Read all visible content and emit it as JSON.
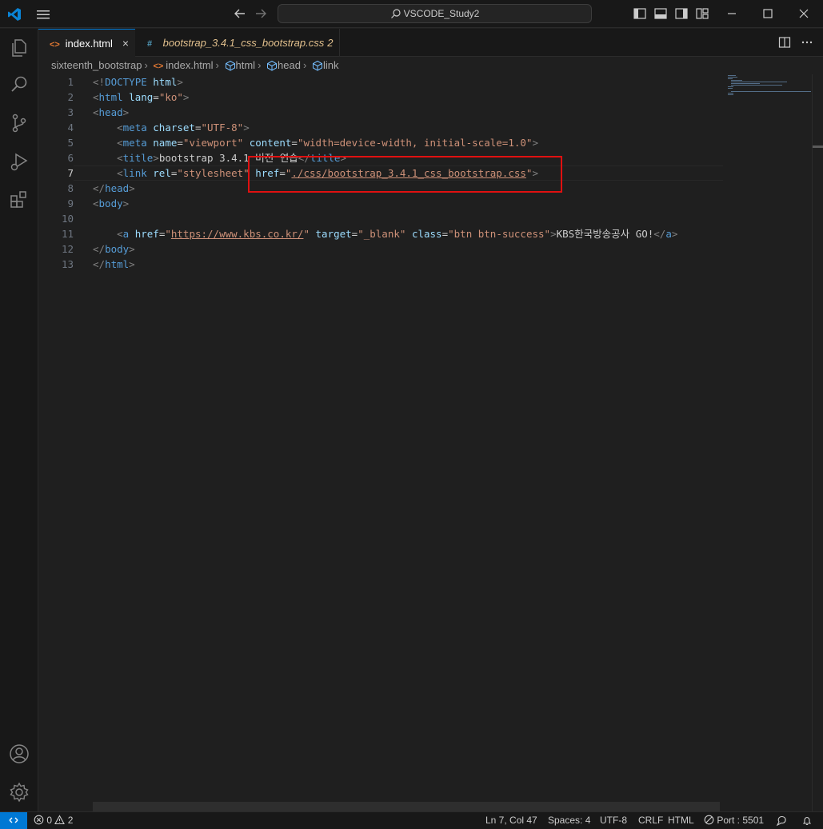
{
  "titlebar": {
    "search_text": "VSCODE_Study2"
  },
  "tabs": [
    {
      "icon": "<>",
      "label": "index.html",
      "close": "×"
    },
    {
      "icon": "#",
      "label": "bootstrap_3.4.1_css_bootstrap.css",
      "badge": "2"
    }
  ],
  "breadcrumb": {
    "folder": "sixteenth_bootstrap",
    "file_icon": "<>",
    "file": "index.html",
    "items": [
      "html",
      "head",
      "link"
    ]
  },
  "editor": {
    "current_line": 7,
    "line_numbers": [
      "1",
      "2",
      "3",
      "4",
      "5",
      "6",
      "7",
      "8",
      "9",
      "10",
      "11",
      "12",
      "13"
    ],
    "lines": [
      [
        [
          "pn",
          "<!"
        ],
        [
          "tg",
          "DOCTYPE"
        ],
        [
          "tx",
          " "
        ],
        [
          "at",
          "html"
        ],
        [
          "pn",
          ">"
        ]
      ],
      [
        [
          "pn",
          "<"
        ],
        [
          "tg",
          "html"
        ],
        [
          "tx",
          " "
        ],
        [
          "at",
          "lang"
        ],
        [
          "tx",
          "="
        ],
        [
          "st",
          "\"ko\""
        ],
        [
          "pn",
          ">"
        ]
      ],
      [
        [
          "pn",
          "<"
        ],
        [
          "tg",
          "head"
        ],
        [
          "pn",
          ">"
        ]
      ],
      [
        [
          "tx",
          "    "
        ],
        [
          "pn",
          "<"
        ],
        [
          "tg",
          "meta"
        ],
        [
          "tx",
          " "
        ],
        [
          "at",
          "charset"
        ],
        [
          "tx",
          "="
        ],
        [
          "st",
          "\"UTF-8\""
        ],
        [
          "pn",
          ">"
        ]
      ],
      [
        [
          "tx",
          "    "
        ],
        [
          "pn",
          "<"
        ],
        [
          "tg",
          "meta"
        ],
        [
          "tx",
          " "
        ],
        [
          "at",
          "name"
        ],
        [
          "tx",
          "="
        ],
        [
          "st",
          "\"viewport\""
        ],
        [
          "tx",
          " "
        ],
        [
          "at",
          "content"
        ],
        [
          "tx",
          "="
        ],
        [
          "st",
          "\"width=device-width, initial-scale=1.0\""
        ],
        [
          "pn",
          ">"
        ]
      ],
      [
        [
          "tx",
          "    "
        ],
        [
          "pn",
          "<"
        ],
        [
          "tg",
          "title"
        ],
        [
          "pn",
          ">"
        ],
        [
          "tx",
          "bootstrap 3.4.1 버전 연습"
        ],
        [
          "pn",
          "</"
        ],
        [
          "tg",
          "title"
        ],
        [
          "pn",
          ">"
        ]
      ],
      [
        [
          "tx",
          "    "
        ],
        [
          "pn",
          "<"
        ],
        [
          "tg",
          "link"
        ],
        [
          "tx",
          " "
        ],
        [
          "at",
          "rel"
        ],
        [
          "tx",
          "="
        ],
        [
          "st",
          "\"stylesheet\""
        ],
        [
          "tx",
          " "
        ],
        [
          "at",
          "href"
        ],
        [
          "tx",
          "="
        ],
        [
          "st",
          "\""
        ],
        [
          "lk",
          "./css/bootstrap_3.4.1_css_bootstrap.css"
        ],
        [
          "st",
          "\""
        ],
        [
          "pn",
          ">"
        ]
      ],
      [
        [
          "pn",
          "</"
        ],
        [
          "tg",
          "head"
        ],
        [
          "pn",
          ">"
        ]
      ],
      [
        [
          "pn",
          "<"
        ],
        [
          "tg",
          "body"
        ],
        [
          "pn",
          ">"
        ]
      ],
      [
        [
          "tx",
          ""
        ]
      ],
      [
        [
          "tx",
          "    "
        ],
        [
          "pn",
          "<"
        ],
        [
          "tg",
          "a"
        ],
        [
          "tx",
          " "
        ],
        [
          "at",
          "href"
        ],
        [
          "tx",
          "="
        ],
        [
          "st",
          "\""
        ],
        [
          "lk",
          "https://www.kbs.co.kr/"
        ],
        [
          "st",
          "\""
        ],
        [
          "tx",
          " "
        ],
        [
          "at",
          "target"
        ],
        [
          "tx",
          "="
        ],
        [
          "st",
          "\"_blank\""
        ],
        [
          "tx",
          " "
        ],
        [
          "at",
          "class"
        ],
        [
          "tx",
          "="
        ],
        [
          "st",
          "\"btn btn-success\""
        ],
        [
          "pn",
          ">"
        ],
        [
          "tx",
          "KBS한국방송공사 GO!"
        ],
        [
          "pn",
          "</"
        ],
        [
          "tg",
          "a"
        ],
        [
          "pn",
          ">"
        ]
      ],
      [
        [
          "pn",
          "</"
        ],
        [
          "tg",
          "body"
        ],
        [
          "pn",
          ">"
        ]
      ],
      [
        [
          "pn",
          "</"
        ],
        [
          "tg",
          "html"
        ],
        [
          "pn",
          ">"
        ]
      ]
    ]
  },
  "statusbar": {
    "errors": "0",
    "warnings": "2",
    "position": "Ln 7, Col 47",
    "spaces": "Spaces: 4",
    "encoding": "UTF-8",
    "eol": "CRLF",
    "language": "HTML",
    "port": "Port : 5501"
  },
  "colors": {
    "accent": "#0078d4",
    "highlight_box": "#e01010",
    "tab_modified": "#e2c08d"
  },
  "icons": [
    "vscode-logo-icon",
    "menu-icon",
    "arrow-left-icon",
    "arrow-right-icon",
    "search-icon",
    "toggle-sidebar-icon",
    "toggle-panel-icon",
    "toggle-secondary-sidebar-icon",
    "customize-layout-icon",
    "minimize-icon",
    "maximize-icon",
    "close-icon",
    "explorer-icon",
    "search-view-icon",
    "source-control-icon",
    "run-debug-icon",
    "extensions-icon",
    "account-icon",
    "settings-gear-icon",
    "split-editor-icon",
    "more-actions-icon",
    "remote-icon",
    "error-icon",
    "warning-icon",
    "port-icon",
    "feedback-icon",
    "bell-icon"
  ]
}
